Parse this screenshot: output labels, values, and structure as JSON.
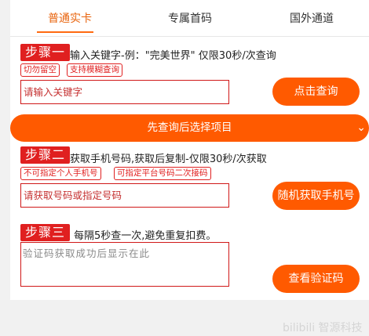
{
  "tabs": [
    {
      "label": "普通实卡",
      "active": true
    },
    {
      "label": "专属首码",
      "active": false
    },
    {
      "label": "国外通道",
      "active": false
    }
  ],
  "step1": {
    "badge": "步骤一",
    "text": "输入关键字-例：\"完美世界\" 仅限30秒/次查询",
    "tags": [
      "切勿留空",
      "支持模糊查询"
    ],
    "input_placeholder": "请输入关键字",
    "button": "点击查询"
  },
  "select": {
    "label": "先查询后选择项目"
  },
  "step2": {
    "badge": "步骤二",
    "text": "获取手机号码,获取后复制-仅限30秒/次获取",
    "tags": [
      "不可指定个人手机号",
      "可指定平台号码二次接码"
    ],
    "input_placeholder": "请获取号码或指定号码",
    "button": "随机获取手机号"
  },
  "step3": {
    "badge": "步骤三",
    "text": "每隔5秒查一次,避免重复扣费。",
    "textarea_placeholder": "验证码获取成功后显示在此",
    "button": "查看验证码"
  },
  "watermark": "bilibili 智源科技",
  "colors": {
    "accent": "#ff5a00",
    "step_red": "#e02020",
    "active_tab": "#e8640e"
  }
}
